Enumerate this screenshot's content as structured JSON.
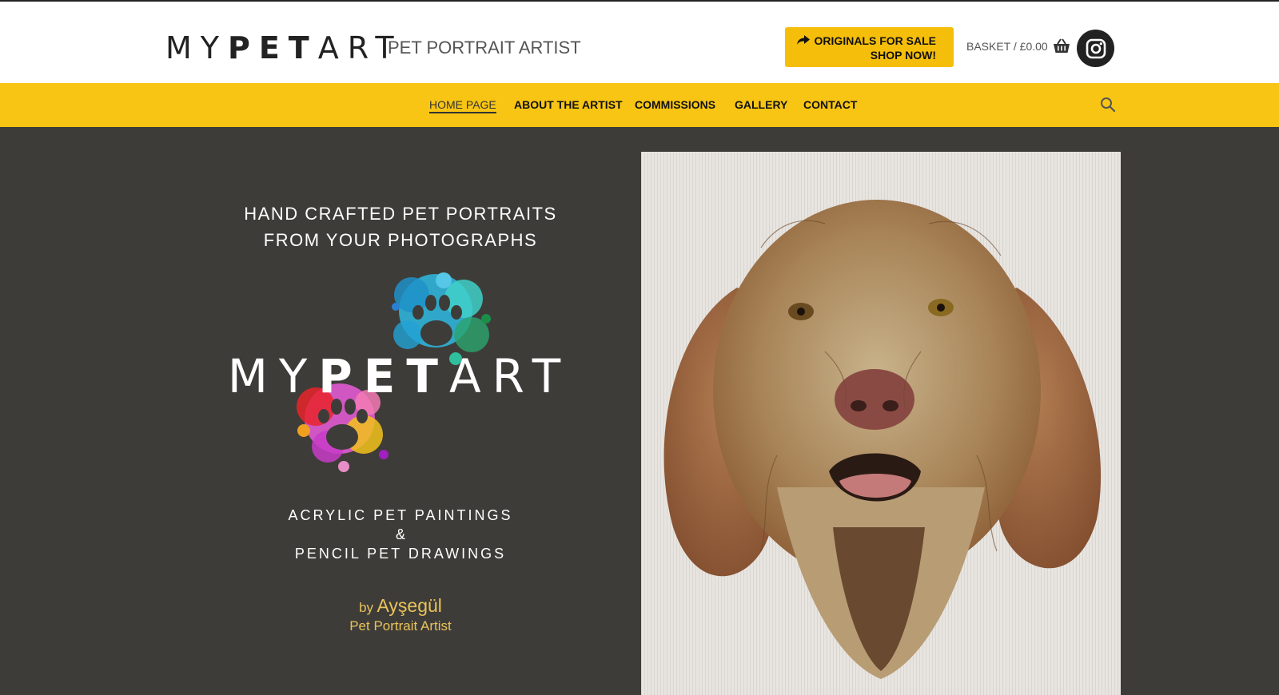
{
  "header": {
    "logo": {
      "thin1": "MY",
      "bold": "PET",
      "thin2": "ART"
    },
    "tagline": "PET PORTRAIT ARTIST",
    "sale_button": {
      "line1": "ORIGINALS FOR SALE",
      "line2": "SHOP NOW!",
      "icon": "share-arrow-icon"
    },
    "basket": {
      "label": "BASKET /",
      "amount": "£0.00",
      "icon": "basket-icon"
    },
    "social": {
      "icon": "instagram-icon"
    }
  },
  "nav": {
    "items": [
      {
        "label": "HOME PAGE",
        "active": true
      },
      {
        "label": "ABOUT THE ARTIST",
        "active": false
      },
      {
        "label": "COMMISSIONS",
        "active": false
      },
      {
        "label": "GALLERY",
        "active": false
      },
      {
        "label": "CONTACT",
        "active": false
      }
    ],
    "search_icon": "search-icon"
  },
  "hero": {
    "headline_line1": "HAND CRAFTED PET PORTRAITS",
    "headline_line2": "FROM YOUR PHOTOGRAPHS",
    "logo": {
      "thin1": "MY",
      "bold": "PET",
      "thin2": "ART"
    },
    "sub_line1": "ACRYLIC PET PAINTINGS",
    "sub_line2": "&",
    "sub_line3": "PENCIL PET DRAWINGS",
    "by": "by",
    "artist_name": "Ayşegül",
    "artist_role": "Pet Portrait Artist"
  },
  "colors": {
    "accent_yellow": "#f8c514",
    "button_yellow": "#f5be0b",
    "hero_background": "#3e3c38",
    "byline_gold": "#e8c35a"
  }
}
